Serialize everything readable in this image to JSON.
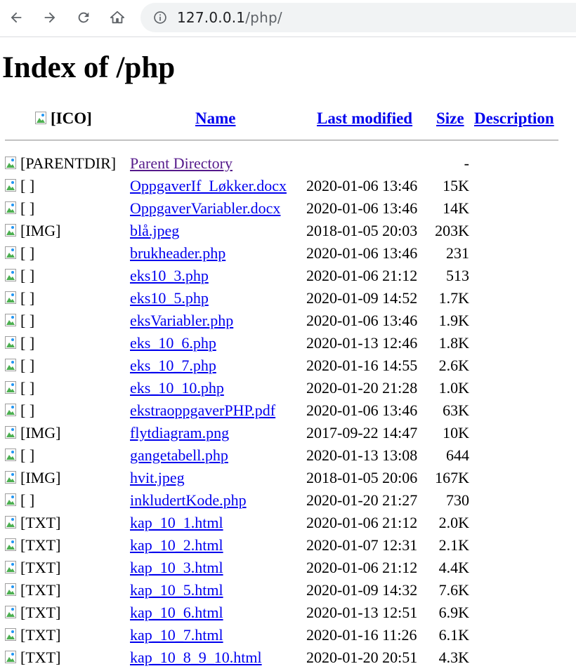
{
  "browser": {
    "url_host": "127.0.0.1",
    "url_path": "/php/"
  },
  "page": {
    "title": "Index of /php",
    "columns": {
      "icon": "[ICO]",
      "name": "Name",
      "last_modified": "Last modified",
      "size": "Size",
      "description": "Description"
    },
    "rows": [
      {
        "icon": "[PARENTDIR]",
        "name": "Parent Directory",
        "date": "",
        "size": "-",
        "visited": true
      },
      {
        "icon": "[ ]",
        "name": "OppgaverIf_Løkker.docx",
        "date": "2020-01-06 13:46",
        "size": "15K"
      },
      {
        "icon": "[ ]",
        "name": "OppgaverVariabler.docx",
        "date": "2020-01-06 13:46",
        "size": "14K"
      },
      {
        "icon": "[IMG]",
        "name": "blå.jpeg",
        "date": "2018-01-05 20:03",
        "size": "203K"
      },
      {
        "icon": "[ ]",
        "name": "brukheader.php",
        "date": "2020-01-06 13:46",
        "size": "231"
      },
      {
        "icon": "[ ]",
        "name": "eks10_3.php",
        "date": "2020-01-06 21:12",
        "size": "513"
      },
      {
        "icon": "[ ]",
        "name": "eks10_5.php",
        "date": "2020-01-09 14:52",
        "size": "1.7K"
      },
      {
        "icon": "[ ]",
        "name": "eksVariabler.php",
        "date": "2020-01-06 13:46",
        "size": "1.9K"
      },
      {
        "icon": "[ ]",
        "name": "eks_10_6.php",
        "date": "2020-01-13 12:46",
        "size": "1.8K"
      },
      {
        "icon": "[ ]",
        "name": "eks_10_7.php",
        "date": "2020-01-16 14:55",
        "size": "2.6K"
      },
      {
        "icon": "[ ]",
        "name": "eks_10_10.php",
        "date": "2020-01-20 21:28",
        "size": "1.0K"
      },
      {
        "icon": "[ ]",
        "name": "ekstraoppgaverPHP.pdf",
        "date": "2020-01-06 13:46",
        "size": "63K"
      },
      {
        "icon": "[IMG]",
        "name": "flytdiagram.png",
        "date": "2017-09-22 14:47",
        "size": "10K"
      },
      {
        "icon": "[ ]",
        "name": "gangetabell.php",
        "date": "2020-01-13 13:08",
        "size": "644"
      },
      {
        "icon": "[IMG]",
        "name": "hvit.jpeg",
        "date": "2018-01-05 20:06",
        "size": "167K"
      },
      {
        "icon": "[ ]",
        "name": "inkludertKode.php",
        "date": "2020-01-20 21:27",
        "size": "730"
      },
      {
        "icon": "[TXT]",
        "name": "kap_10_1.html",
        "date": "2020-01-06 21:12",
        "size": "2.0K"
      },
      {
        "icon": "[TXT]",
        "name": "kap_10_2.html",
        "date": "2020-01-07 12:31",
        "size": "2.1K"
      },
      {
        "icon": "[TXT]",
        "name": "kap_10_3.html",
        "date": "2020-01-06 21:12",
        "size": "4.4K"
      },
      {
        "icon": "[TXT]",
        "name": "kap_10_5.html",
        "date": "2020-01-09 14:32",
        "size": "7.6K"
      },
      {
        "icon": "[TXT]",
        "name": "kap_10_6.html",
        "date": "2020-01-13 12:51",
        "size": "6.9K"
      },
      {
        "icon": "[TXT]",
        "name": "kap_10_7.html",
        "date": "2020-01-16 11:26",
        "size": "6.1K"
      },
      {
        "icon": "[TXT]",
        "name": "kap_10_8_9_10.html",
        "date": "2020-01-20 20:51",
        "size": "4.3K"
      }
    ]
  },
  "colors": {
    "link": "#0000ee",
    "visited_link": "#551a8b",
    "omnibox_bg": "#f1f3f4"
  }
}
